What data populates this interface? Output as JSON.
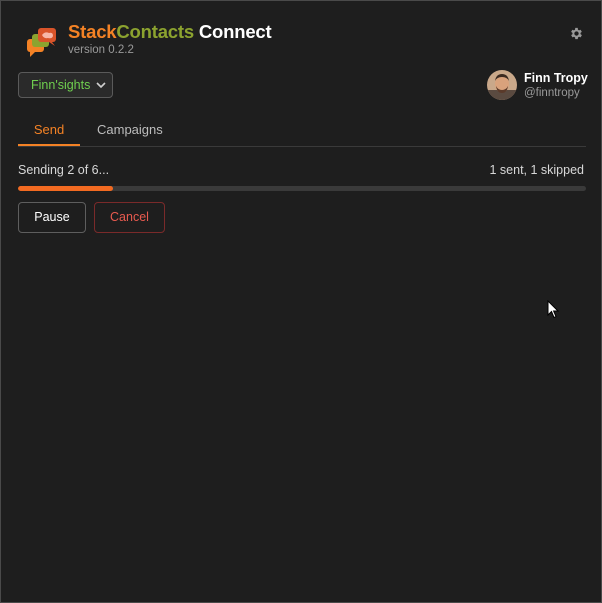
{
  "header": {
    "brand_stack": "Stack",
    "brand_contacts": "Contacts",
    "brand_connect": " Connect",
    "version": "version 0.2.2",
    "settings_icon": "gear-icon"
  },
  "publication_select": {
    "selected": "Finn'sights"
  },
  "user": {
    "name": "Finn Tropy",
    "handle": "@finntropy"
  },
  "tabs": [
    {
      "label": "Send",
      "active": true
    },
    {
      "label": "Campaigns",
      "active": false
    }
  ],
  "progress": {
    "status": "Sending 2 of 6...",
    "summary": "1 sent, 1 skipped",
    "fraction": 0.167
  },
  "actions": {
    "pause_label": "Pause",
    "cancel_label": "Cancel"
  },
  "colors": {
    "accent": "#f48225",
    "brand_green": "#8ca32f",
    "select_text": "#6fcf4f",
    "cancel": "#e85a4f"
  }
}
